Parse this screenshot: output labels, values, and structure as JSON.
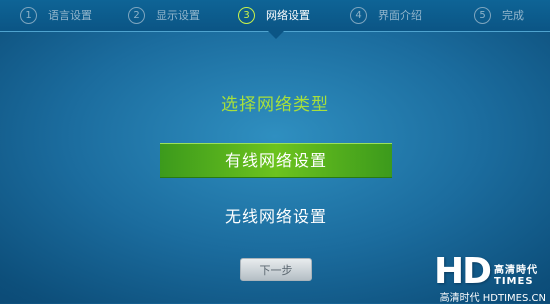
{
  "steps": [
    {
      "num": "1",
      "label": "语言设置",
      "active": false
    },
    {
      "num": "2",
      "label": "显示设置",
      "active": false
    },
    {
      "num": "3",
      "label": "网络设置",
      "active": true
    },
    {
      "num": "4",
      "label": "界面介绍",
      "active": false
    },
    {
      "num": "5",
      "label": "完成",
      "active": false
    }
  ],
  "main": {
    "heading": "选择网络类型",
    "options": [
      {
        "label": "有线网络设置",
        "selected": true
      },
      {
        "label": "无线网络设置",
        "selected": false
      }
    ],
    "next_button": "下一步"
  },
  "watermark": {
    "logo_hd": "HD",
    "logo_cn": "高清時代",
    "logo_en": "TIMES",
    "caption": "高清时代 HDTIMES.CN"
  },
  "colors": {
    "accent_green": "#a7e03c",
    "selected_bar": "#5cb41c",
    "active_step": "#c8f24a",
    "background": "#1b6c9e"
  }
}
